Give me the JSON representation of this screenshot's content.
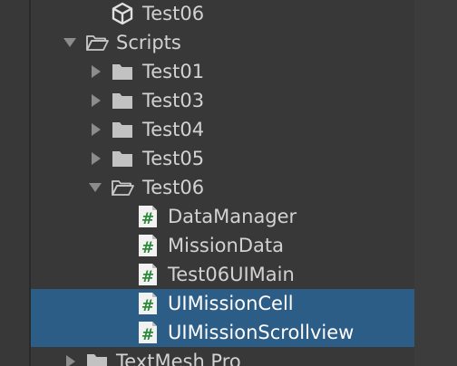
{
  "tree": {
    "unity_scene": {
      "label": "Test06",
      "icon": "unity-scene-icon"
    },
    "scripts": {
      "label": "Scripts",
      "expanded": true,
      "icon": "folder-open-icon"
    },
    "folders": [
      {
        "label": "Test01",
        "expanded": false
      },
      {
        "label": "Test03",
        "expanded": false
      },
      {
        "label": "Test04",
        "expanded": false
      },
      {
        "label": "Test05",
        "expanded": false
      },
      {
        "label": "Test06",
        "expanded": true
      }
    ],
    "scripts_files": [
      {
        "label": "DataManager",
        "selected": false
      },
      {
        "label": "MissionData",
        "selected": false
      },
      {
        "label": "Test06UIMain",
        "selected": false
      },
      {
        "label": "UIMissionCell",
        "selected": true
      },
      {
        "label": "UIMissionScrollview",
        "selected": true
      }
    ],
    "textmesh": {
      "label": "TextMesh Pro",
      "expanded": false
    }
  },
  "colors": {
    "background": "#383838",
    "selection": "#2c5d87",
    "text": "#d2d2d2",
    "selected_text": "#ffffff",
    "script_icon_green": "#2d8a3a"
  }
}
